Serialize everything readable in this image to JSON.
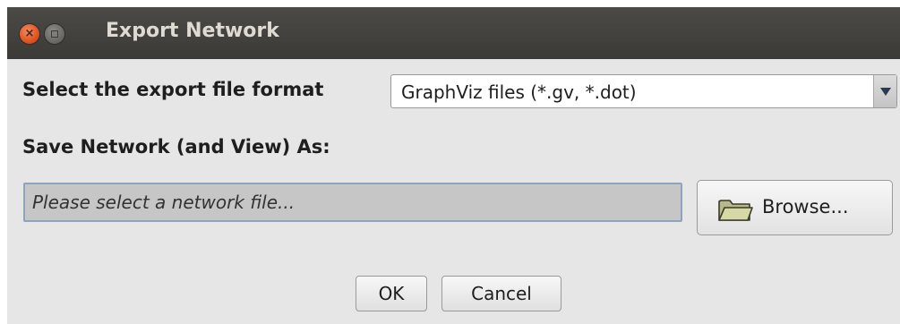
{
  "window": {
    "title": "Export Network",
    "close_icon": "close-icon",
    "minimize_icon": "minimize-icon",
    "close_glyph": "×"
  },
  "format": {
    "label": "Select the export file format",
    "selected": "GraphViz files (*.gv, *.dot)",
    "arrow_icon": "chevron-down-icon"
  },
  "save": {
    "label": "Save Network (and View) As:",
    "file_value": "",
    "file_placeholder": "Please select a network file...",
    "browse_label": "Browse...",
    "browse_icon": "folder-icon"
  },
  "actions": {
    "ok_label": "OK",
    "cancel_label": "Cancel"
  },
  "colors": {
    "titlebar": "#3f3e3a",
    "close_button": "#e0531f",
    "dialog_background": "#e6e6e6",
    "input_background": "#c6c6c6",
    "input_focus_border": "#8ea4bd"
  }
}
